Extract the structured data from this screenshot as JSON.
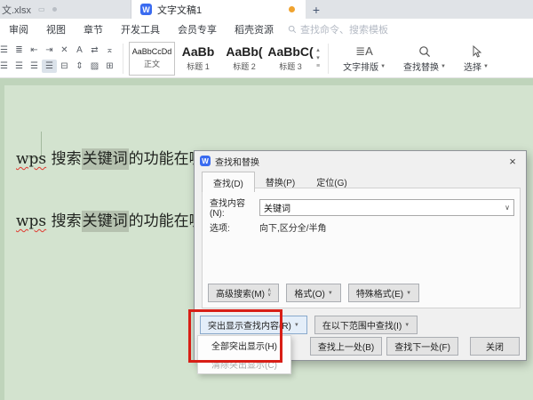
{
  "window": {
    "tabs": [
      {
        "label": "文.xlsx"
      },
      {
        "label": "文字文稿1"
      }
    ],
    "new_tab_label": "+"
  },
  "menu": {
    "items": [
      "审阅",
      "视图",
      "章节",
      "开发工具",
      "会员专享",
      "稻壳资源"
    ],
    "search_placeholder": "查找命令、搜索模板"
  },
  "toolbar": {
    "styles": [
      {
        "preview": "AaBbCcDd",
        "label": "正文"
      },
      {
        "preview": "AaBb",
        "label": "标题 1"
      },
      {
        "preview": "AaBb(",
        "label": "标题 2"
      },
      {
        "preview": "AaBbC(",
        "label": "标题 3"
      }
    ],
    "tools": [
      {
        "label": "文字排版"
      },
      {
        "label": "查找替换"
      },
      {
        "label": "选择"
      }
    ]
  },
  "document": {
    "line1": {
      "word": "wps",
      "mid": " 搜索",
      "highlight": "关键词",
      "rest": "的功能在哪"
    },
    "line2": {
      "word": "wps",
      "mid": " 搜索",
      "highlight": "关键词",
      "rest": "的功能在哪"
    }
  },
  "dialog": {
    "title": "查找和替换",
    "tabs": [
      "查找(D)",
      "替换(P)",
      "定位(G)"
    ],
    "find_label": "查找内容(N):",
    "find_value": "关键词",
    "options_label": "选项:",
    "options_value": "向下,区分全/半角",
    "advanced_button": "高级搜索(M)",
    "format_button": "格式(O)",
    "special_button": "特殊格式(E)",
    "highlight_button": "突出显示查找内容(R)",
    "scope_button": "在以下范围中查找(I)",
    "find_prev_button": "查找上一处(B)",
    "find_next_button": "查找下一处(F)",
    "close_button": "关闭",
    "highlight_menu": [
      {
        "label": "全部突出显示(H)"
      },
      {
        "label": "清除突出显示(C)"
      }
    ]
  },
  "icons": {
    "wps_logo": "W",
    "device": "▭",
    "close": "×",
    "caret_down": "▼",
    "chevron_down": "∨",
    "chevron_up": "∧",
    "spinner_up": "▴",
    "spinner_down": "▾",
    "spinner_menu": "≡",
    "row1": [
      "☰",
      "≣",
      "⇤",
      "⇥",
      "✕",
      "A",
      "⇄",
      "⌅"
    ],
    "row2": [
      "☰",
      "☰",
      "☰",
      "☰",
      "⊟",
      "⇕",
      "▨",
      "⊞"
    ],
    "text_layout": "≣A"
  },
  "colors": {
    "accent_blue": "#3a6bf0",
    "unsaved_orange": "#f0a32f",
    "annotation_red": "#d81e16",
    "doc_outer_green": "#bfd4bb",
    "page_green": "#d3e3cf",
    "highlight_gray_green": "#b5c1af"
  }
}
